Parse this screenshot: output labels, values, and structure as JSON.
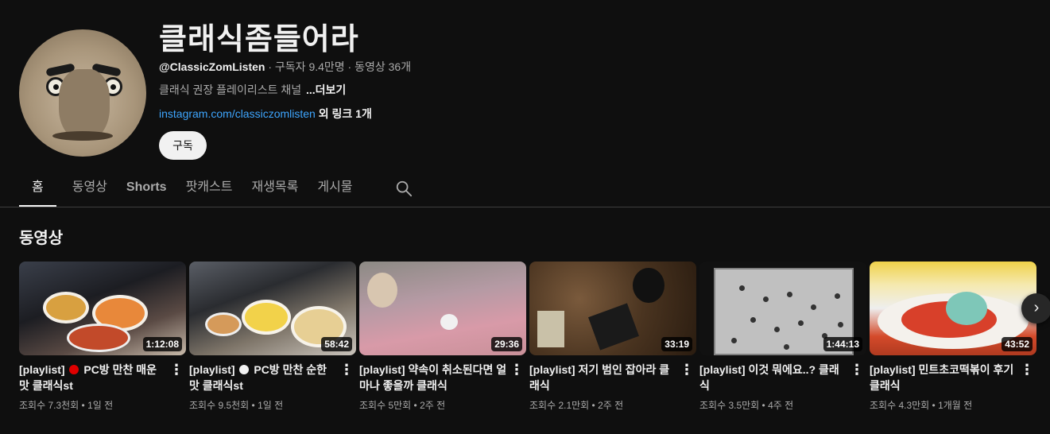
{
  "channel": {
    "name": "클래식좀들어라",
    "handle": "@ClassicZomListen",
    "meta_rest": " · 구독자 9.4만명 · 동영상 36개",
    "description": "클래식 권장 플레이리스트 채널",
    "more_label": "...더보기",
    "link": "instagram.com/classiczomlisten",
    "link_extra": " 외 링크 1개",
    "subscribe_label": "구독"
  },
  "tabs": [
    {
      "label": "홈",
      "active": true
    },
    {
      "label": "동영상"
    },
    {
      "label": "Shorts"
    },
    {
      "label": "팟캐스트"
    },
    {
      "label": "재생목록"
    },
    {
      "label": "게시물"
    }
  ],
  "section": {
    "title": "동영상"
  },
  "videos": [
    {
      "prefix": "[playlist] ",
      "dot": "red",
      "title": "PC방 만찬 매운 맛 클래식st",
      "duration": "1:12:08",
      "stats": "조회수 7.3천회 • 1일 전"
    },
    {
      "prefix": "[playlist] ",
      "dot": "white",
      "title": "PC방 만찬 순한 맛 클래식st",
      "duration": "58:42",
      "stats": "조회수 9.5천회 • 1일 전"
    },
    {
      "prefix": "[playlist] ",
      "title": "약속이 취소된다면 얼마나 좋을까 클래식",
      "duration": "29:36",
      "stats": "조회수 5만회 • 2주 전"
    },
    {
      "prefix": "[playlist] ",
      "title": "저기 범인 잡아라 클래식",
      "duration": "33:19",
      "stats": "조회수 2.1만회 • 2주 전"
    },
    {
      "prefix": "[playlist] ",
      "title": "이것 뭐에요..? 클래식",
      "duration": "1:44:13",
      "stats": "조회수 3.5만회 • 4주 전"
    },
    {
      "prefix": "[playlist] ",
      "title": "민트초코떡볶이 후기 클래식",
      "duration": "43:52",
      "stats": "조회수 4.3만회 • 1개월 전"
    }
  ],
  "icons": {
    "search": "search-icon",
    "next": "chevron-right-icon",
    "more": "more-vert-icon"
  }
}
